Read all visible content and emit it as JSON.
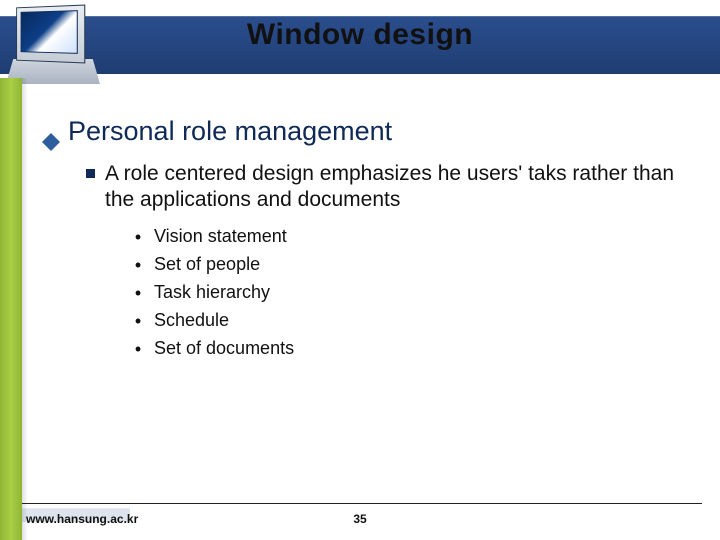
{
  "title": "Window design",
  "heading": "Personal role management",
  "sub": "A role centered design emphasizes he users' taks rather than the applications and documents",
  "bullets": [
    "Vision statement",
    "Set of people",
    "Task hierarchy",
    "Schedule",
    "Set of documents"
  ],
  "footer": {
    "url": "www.hansung.ac.kr",
    "page": "35"
  },
  "icons": {
    "diamond": "diamond-bullet-icon",
    "square": "square-bullet-icon",
    "dot": "dot-bullet-icon"
  }
}
